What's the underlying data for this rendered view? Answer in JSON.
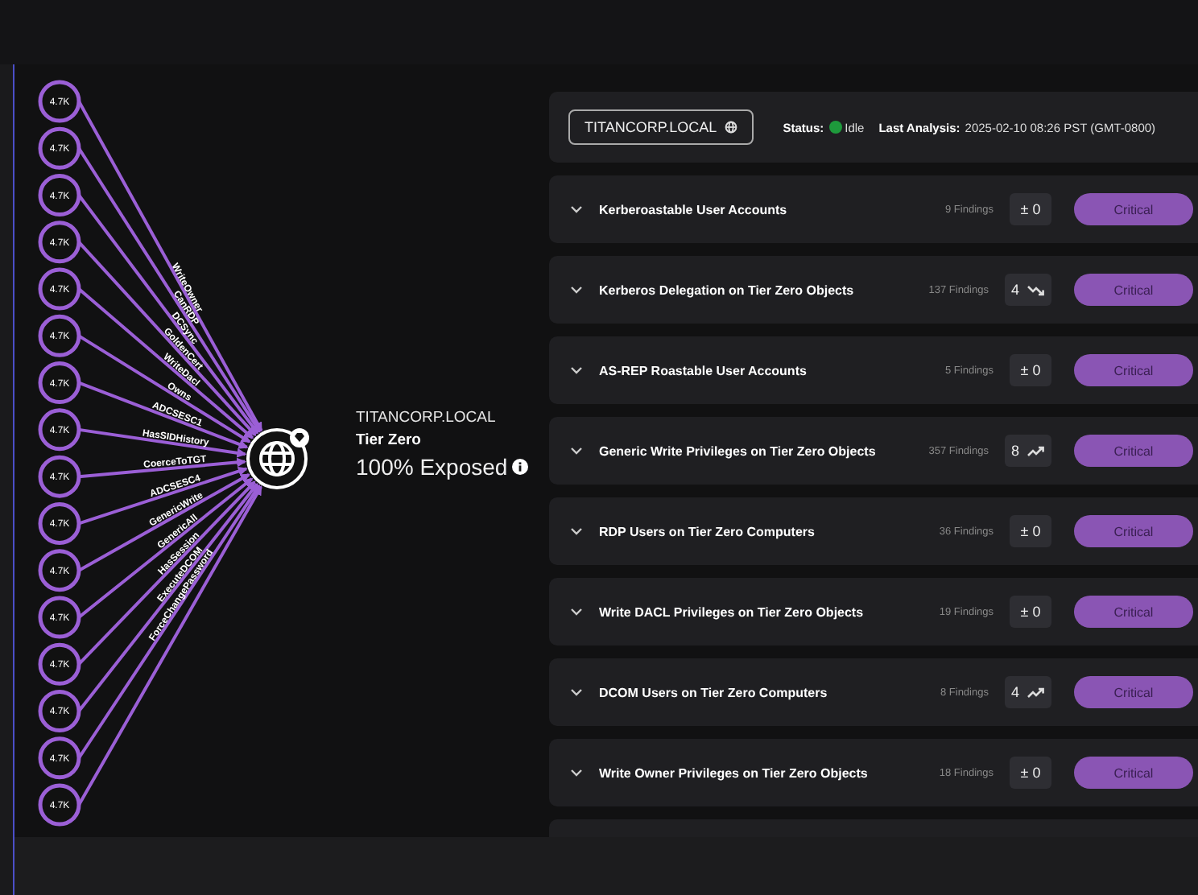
{
  "graph": {
    "sources": [
      "4.7K",
      "4.7K",
      "4.7K",
      "4.7K",
      "4.7K",
      "4.7K",
      "4.7K",
      "4.7K",
      "4.7K",
      "4.7K",
      "4.7K",
      "4.7K",
      "4.7K",
      "4.7K",
      "4.7K",
      "4.7K"
    ],
    "edges": [
      "WriteOwner",
      "CanRDP",
      "DCSync",
      "GoldenCert",
      "WriteDacl",
      "Owns",
      "ADCSESC1",
      "HasSIDHistory",
      "CoerceToTGT",
      "ADCSESC4",
      "GenericWrite",
      "GenericAll",
      "HasSession",
      "ExecuteDCOM",
      "ForceChangePassword"
    ],
    "target": {
      "domain": "TITANCORP.LOCAL",
      "tier": "Tier Zero",
      "exposure": "100% Exposed"
    }
  },
  "header": {
    "domain_button": "TITANCORP.LOCAL",
    "status_label": "Status:",
    "status": "Idle",
    "analysis_label": "Last Analysis:",
    "analysis": "2025-02-10 08:26 PST (GMT-0800)"
  },
  "findings": [
    {
      "title": "Kerberoastable User Accounts",
      "count": "9 Findings",
      "change": "± 0",
      "kind": "flat",
      "severity": "Critical",
      "expanded": false
    },
    {
      "title": "Kerberos Delegation on Tier Zero Objects",
      "count": "137 Findings",
      "change": "4",
      "kind": "down",
      "severity": "Critical",
      "expanded": false
    },
    {
      "title": "AS-REP Roastable User Accounts",
      "count": "5 Findings",
      "change": "± 0",
      "kind": "flat",
      "severity": "Critical",
      "expanded": false
    },
    {
      "title": "Generic Write Privileges on Tier Zero Objects",
      "count": "357 Findings",
      "change": "8",
      "kind": "up",
      "severity": "Critical",
      "expanded": false
    },
    {
      "title": "RDP Users on Tier Zero Computers",
      "count": "36 Findings",
      "change": "± 0",
      "kind": "flat",
      "severity": "Critical",
      "expanded": false
    },
    {
      "title": "Write DACL Privileges on Tier Zero Objects",
      "count": "19 Findings",
      "change": "± 0",
      "kind": "flat",
      "severity": "Critical",
      "expanded": false
    },
    {
      "title": "DCOM Users on Tier Zero Computers",
      "count": "8 Findings",
      "change": "4",
      "kind": "up",
      "severity": "Critical",
      "expanded": false
    },
    {
      "title": "Write Owner Privileges on Tier Zero Objects",
      "count": "18 Findings",
      "change": "± 0",
      "kind": "flat",
      "severity": "Critical",
      "expanded": false
    }
  ]
}
